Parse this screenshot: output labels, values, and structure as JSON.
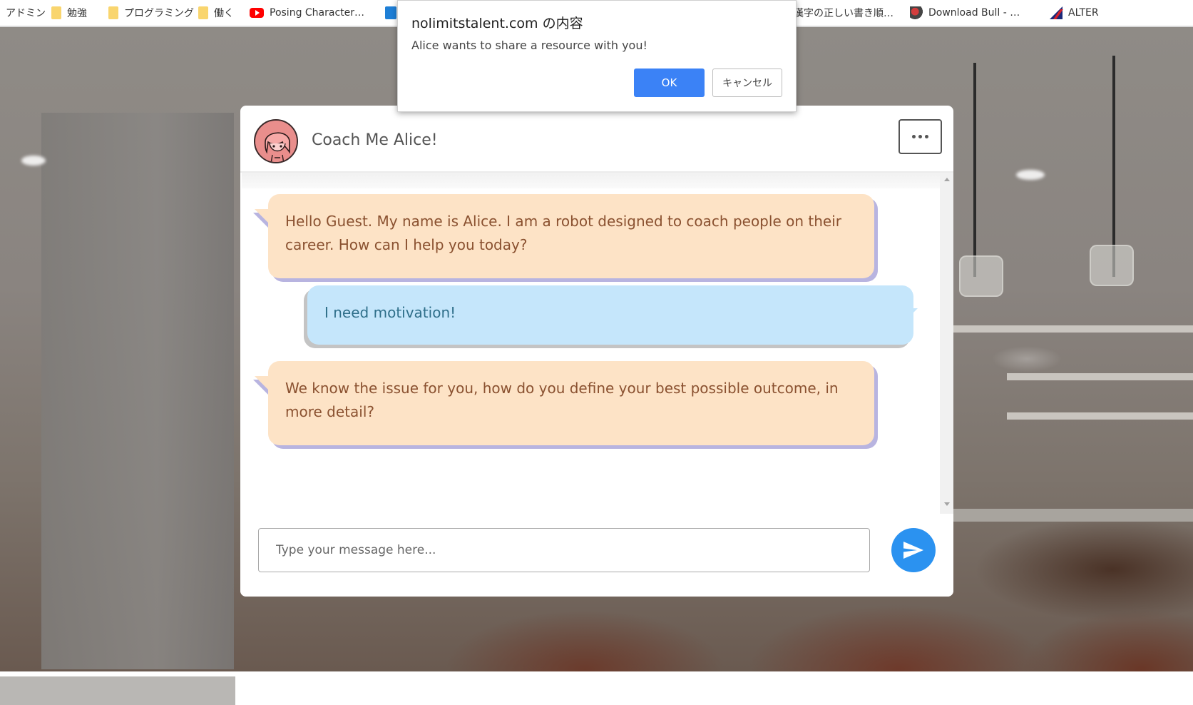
{
  "bookmarks": [
    {
      "label": "アドミン",
      "icon": "none"
    },
    {
      "label": "勉強",
      "icon": "folder-icon"
    },
    {
      "label": "プログラミング",
      "icon": "folder-icon"
    },
    {
      "label": "働く",
      "icon": "folder-icon"
    },
    {
      "label": "Posing Character…",
      "icon": "youtube-icon"
    },
    {
      "label": "漢字の正しい書き順…",
      "icon": "none"
    },
    {
      "label": "Download Bull - …",
      "icon": "bull-icon"
    },
    {
      "label": "ALTER",
      "icon": "alter-icon"
    }
  ],
  "dialog": {
    "title": "nolimitstalent.com の内容",
    "message": "Alice wants to share a resource with you!",
    "ok_label": "OK",
    "cancel_label": "キャンセル"
  },
  "chat": {
    "title": "Coach Me Alice!",
    "messages": [
      {
        "sender": "bot",
        "text": "Hello Guest. My name is Alice. I am a robot designed to coach people on their career. How can I help you today?"
      },
      {
        "sender": "user",
        "text": "I need motivation!"
      },
      {
        "sender": "bot",
        "text": "We know the issue for you, how do you define your best possible outcome, in more detail?"
      }
    ],
    "input": {
      "value": "",
      "placeholder": "Type your message here..."
    }
  },
  "colors": {
    "bot_bubble": "#fde3c6",
    "bot_text": "#8a5130",
    "user_bubble": "#c5e6fb",
    "user_text": "#2f6f8a",
    "accent": "#2b92f0",
    "ok_button": "#3b82f6"
  }
}
